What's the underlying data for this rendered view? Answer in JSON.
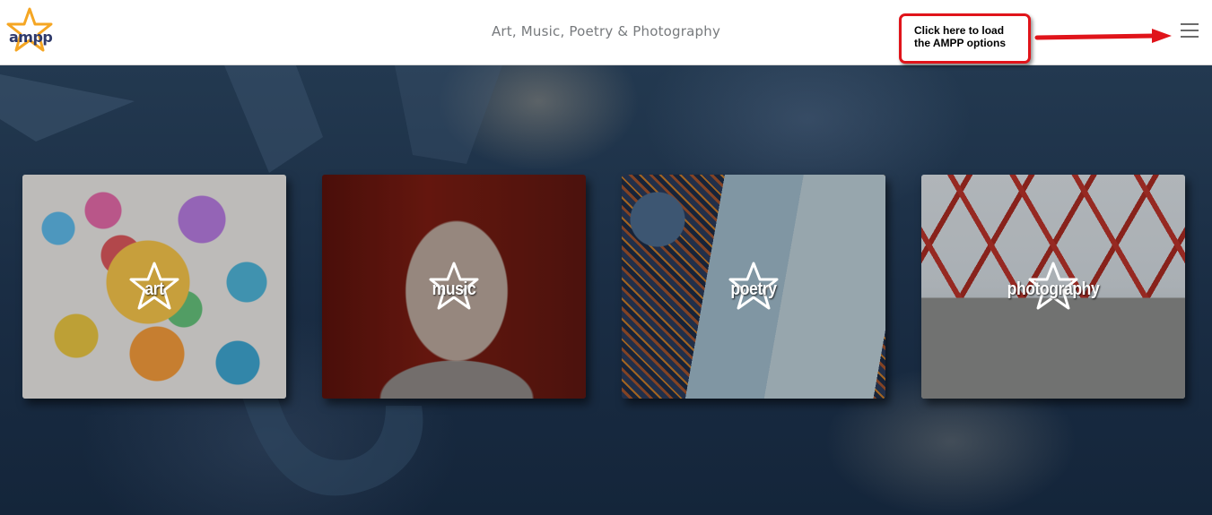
{
  "header": {
    "logo_text": "ampp",
    "site_title": "Art, Music, Poetry & Photography",
    "menu_icon": "hamburger-menu-icon"
  },
  "callout": {
    "text": "Click here to load\nthe AMPP options",
    "border_color": "#e0141a",
    "arrow_color": "#e0141a"
  },
  "cards": [
    {
      "label": "art"
    },
    {
      "label": "music"
    },
    {
      "label": "poetry"
    },
    {
      "label": "photography"
    }
  ],
  "colors": {
    "logo_star": "#f5a623",
    "logo_text": "#2f3a6b",
    "background": "#1a2d44"
  }
}
